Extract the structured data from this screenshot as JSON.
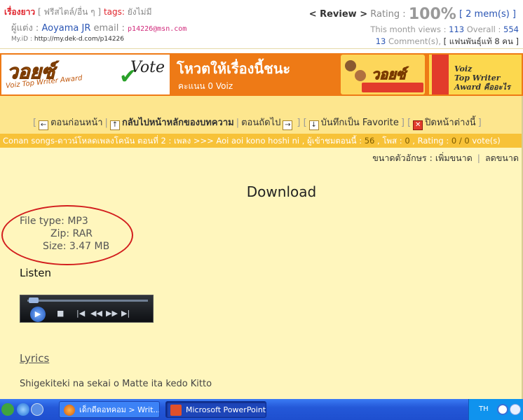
{
  "header": {
    "title": "เรื่องยาว",
    "genre": "[ ฟรีสไตล์/อื่น ๆ ]",
    "tags_label": "tags:",
    "tags_value": "ยังไม่มี",
    "author_label": "ผู้แต่ง :",
    "author": "Aoyama JR",
    "email_label": "email :",
    "email": "p14226@msn.com",
    "myid_label": "My.iD :",
    "myid_url": "http://my.dek-d.com/p14226",
    "review_label": "< Review >",
    "rating_label": "Rating :",
    "rating_value": "100%",
    "rating_mems": "[ 2 mem(s) ]",
    "views_label": "This month views :",
    "views_month": "113",
    "overall_label": "Overall :",
    "overall": "554",
    "comments_count": "13",
    "comments_label": "Comment(s),",
    "fans_label": "[ แฟนพันธุ์แท้ 8 คน ]"
  },
  "banner": {
    "logo": "วอยซ์",
    "award_text": "Voiz Top Writer Award",
    "vote_text": "Vote",
    "vote_title": "โหวตให้เรื่องนี้ชนะ",
    "score_text": "คะแนน 0 Voiz",
    "pack_logo": "วอยซ์",
    "right_text": [
      "Voiz",
      "Top Writer",
      "Award คืออะไร"
    ]
  },
  "nav": {
    "prev": "ตอนก่อนหน้า",
    "back": "กลับไปหน้าหลักของบทความ",
    "next": "ตอนถัดไป",
    "favorite": "บันทึกเป็น Favorite",
    "close": "ปิดหน้าต่างนี้"
  },
  "crumb": {
    "path": "Conan songs-ดาวน์โหลดเพลงโคนัน ตอนที่ 2 : เพลง >>> Aoi aoi kono hoshi ni , ผู้เข้าชมตอนนี้ :",
    "views": "56",
    "posts_label": ", โพส :",
    "posts": "0",
    "rating_label": ", Rating :",
    "rating": "0 / 0",
    "votes_label": "vote(s)"
  },
  "fontsize": {
    "label": "ขนาดตัวอักษร :",
    "increase": "เพิ่มขนาด",
    "decrease": "ลดขนาด"
  },
  "content": {
    "download_title": "Download",
    "file_type": "File type: MP3",
    "zip": "Zip: RAR",
    "size": "Size: 3.47 MB",
    "listen": "Listen",
    "lyrics": "Lyrics",
    "lyric_line": "Shigekiteki na sekai o Matte ita kedo Kitto"
  },
  "taskbar": {
    "window1": "เด็กดีดอทคอม > Writ...",
    "window2": "Microsoft PowerPoint ...",
    "lang": "TH"
  }
}
